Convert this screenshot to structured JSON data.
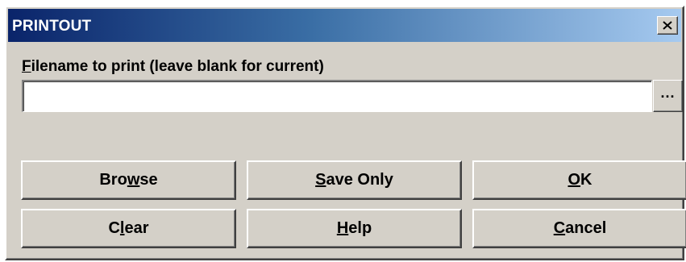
{
  "window": {
    "title": "PRINTOUT",
    "close_icon": "close-x-icon"
  },
  "filename": {
    "label_prefix": "F",
    "label_rest": "ilename to print (leave blank for current)",
    "value": "",
    "browse_ellipsis": "..."
  },
  "buttons": {
    "browse": {
      "pre": "Bro",
      "u": "w",
      "post": "se"
    },
    "save_only": {
      "pre": "",
      "u": "S",
      "post": "ave Only"
    },
    "ok": {
      "pre": "",
      "u": "O",
      "post": "K"
    },
    "clear": {
      "pre": "C",
      "u": "l",
      "post": "ear"
    },
    "help": {
      "pre": "",
      "u": "H",
      "post": "elp"
    },
    "cancel": {
      "pre": "",
      "u": "C",
      "post": "ancel"
    }
  },
  "colors": {
    "titlebar_start": "#0a246a",
    "titlebar_end": "#a6caf0",
    "face": "#d4d0c8"
  }
}
